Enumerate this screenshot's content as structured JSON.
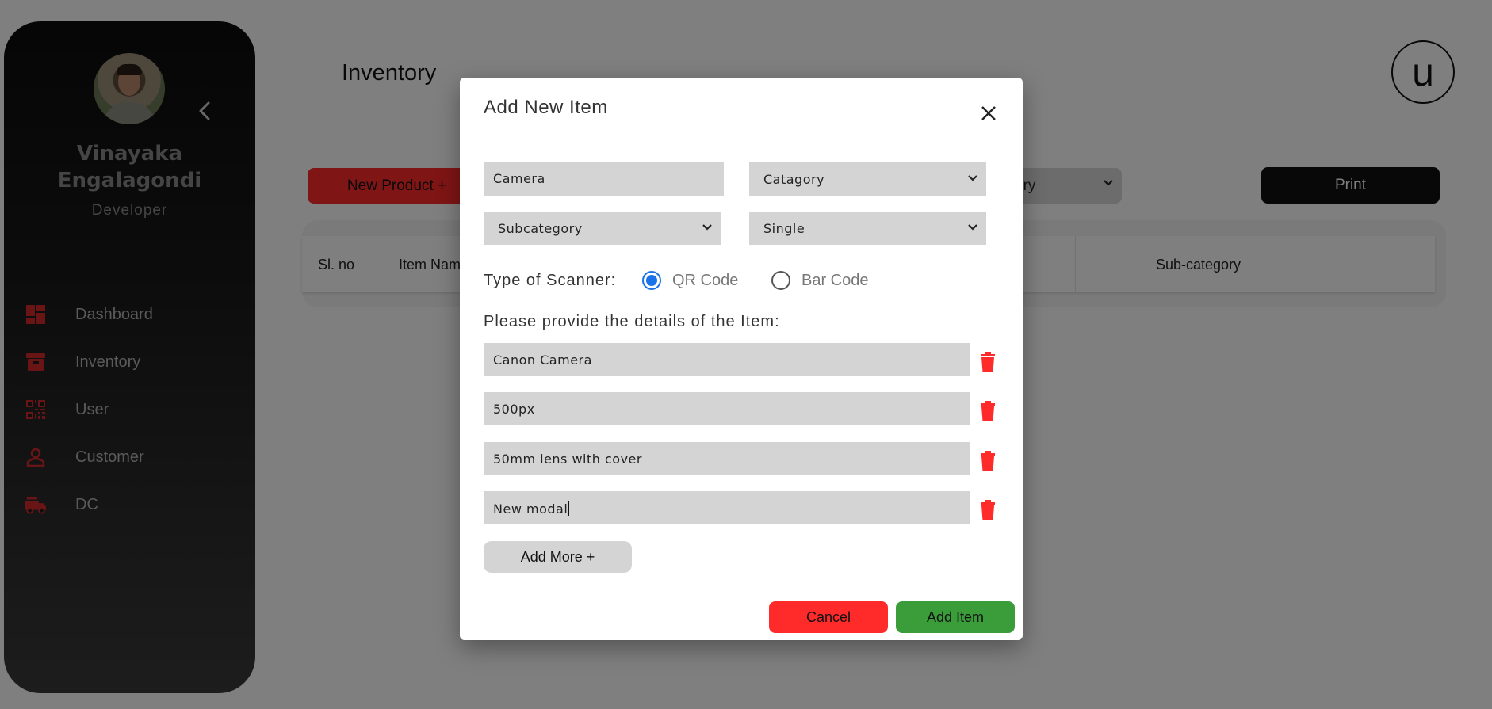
{
  "sidebar": {
    "user_name": "Vinayaka Engalagondi",
    "user_role": "Developer",
    "items": [
      {
        "label": "Dashboard",
        "icon": "dashboard-icon"
      },
      {
        "label": "Inventory",
        "icon": "archive-box-icon"
      },
      {
        "label": "User",
        "icon": "qr-code-icon"
      },
      {
        "label": "Customer",
        "icon": "person-icon"
      },
      {
        "label": "DC",
        "icon": "fire-truck-icon"
      }
    ],
    "icon_color": "#d42a2a"
  },
  "header": {
    "page_title": "Inventory",
    "user_initial": "u"
  },
  "toolbar": {
    "new_product_label": "New Product +",
    "category_filter_partial": "ory",
    "print_label": "Print"
  },
  "table": {
    "columns": [
      "Sl. no",
      "Item Nam",
      "Sub-category"
    ]
  },
  "modal": {
    "title": "Add New Item",
    "item_name_value": "Camera",
    "category_select": "Catagory",
    "subcategory_select": "Subcategory",
    "type_select": "Single",
    "scanner_label": "Type of Scanner:",
    "scanner_options": [
      {
        "label": "QR Code",
        "selected": true
      },
      {
        "label": "Bar Code",
        "selected": false
      }
    ],
    "details_label": "Please provide the details of the Item:",
    "details": [
      "Canon Camera",
      "500px",
      "50mm lens with cover",
      "New modal"
    ],
    "add_more_label": "Add More +",
    "cancel_label": "Cancel",
    "add_item_label": "Add Item"
  },
  "colors": {
    "accent_red": "#ff2a2a",
    "accent_green": "#3a9d3a",
    "radio_blue": "#1a73e8"
  }
}
